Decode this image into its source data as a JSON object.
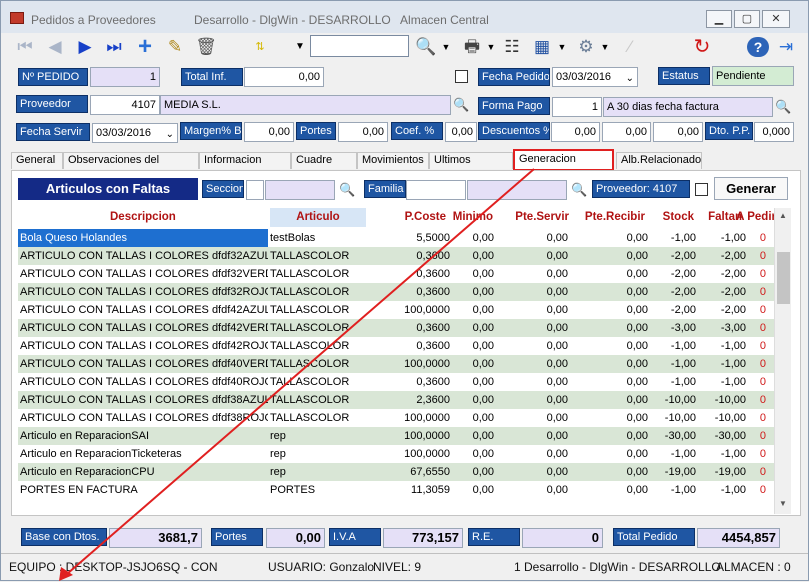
{
  "window": {
    "app_title": "Pedidos a Proveedores",
    "context_title": "Desarrollo - DlgWin - DESARROLLO   Almacen Central"
  },
  "toolbar": {
    "search_value": ""
  },
  "header": {
    "pedido_label": "Nº PEDIDO",
    "pedido_value": "1",
    "total_inf_label": "Total Inf.",
    "total_inf_value": "0,00",
    "fecha_pedido_label": "Fecha Pedido",
    "fecha_pedido_value": "03/03/2016",
    "estatus_label": "Estatus",
    "estatus_value": "Pendiente",
    "proveedor_label": "Proveedor",
    "proveedor_code": "4107",
    "proveedor_name": "MEDIA S.L.",
    "forma_pago_label": "Forma Pago",
    "forma_pago_code": "1",
    "forma_pago_name": "A 30 dias fecha factura",
    "fecha_servir_label": "Fecha Servir",
    "fecha_servir_value": "03/03/2016",
    "margen_label": "Margen% B",
    "margen_value": "0,00",
    "portes_label": "Portes",
    "portes_value": "0,00",
    "coef_label": "Coef. %",
    "coef_value": "0,00",
    "descuentos_label": "Descuentos %",
    "desc1": "0,00",
    "desc2": "0,00",
    "desc3": "0,00",
    "dto_pp_label": "Dto. P.P.",
    "dto_pp_value": "0,000"
  },
  "tabs": [
    "General",
    "Observaciones del Pedido",
    "Informacion Final",
    "Cuadre IVA",
    "Movimientos",
    "Ultimos Precios",
    "Generacion Pedido",
    "Alb.Relacionado"
  ],
  "active_tab": "Generacion Pedido",
  "panel": {
    "title": "Articulos con Faltas",
    "seccion_label": "Seccion",
    "familia_label": "Familia",
    "proveedor_label": "Proveedor: 4107",
    "generar_label": "Generar"
  },
  "grid": {
    "headers": [
      "Descripcion",
      "Articulo",
      "P.Coste",
      "Minimo",
      "Pte.Servir",
      "Pte.Recibir",
      "Stock",
      "Faltan",
      "A Pedir"
    ],
    "rows": [
      [
        "Bola Queso Holandes",
        "testBolas",
        "5,5000",
        "0,00",
        "0,00",
        "0,00",
        "-1,00",
        "-1,00",
        "0"
      ],
      [
        "ARTICULO CON TALLAS I COLORES dfdf32AZUL",
        "TALLASCOLOR",
        "0,3600",
        "0,00",
        "0,00",
        "0,00",
        "-2,00",
        "-2,00",
        "0"
      ],
      [
        "ARTICULO CON TALLAS I COLORES dfdf32VERD",
        "TALLASCOLOR",
        "0,3600",
        "0,00",
        "0,00",
        "0,00",
        "-2,00",
        "-2,00",
        "0"
      ],
      [
        "ARTICULO CON TALLAS I COLORES dfdf32ROJO",
        "TALLASCOLOR",
        "0,3600",
        "0,00",
        "0,00",
        "0,00",
        "-2,00",
        "-2,00",
        "0"
      ],
      [
        "ARTICULO CON TALLAS I COLORES dfdf42AZUL",
        "TALLASCOLOR",
        "100,0000",
        "0,00",
        "0,00",
        "0,00",
        "-2,00",
        "-2,00",
        "0"
      ],
      [
        "ARTICULO CON TALLAS I COLORES dfdf42VERD",
        "TALLASCOLOR",
        "0,3600",
        "0,00",
        "0,00",
        "0,00",
        "-3,00",
        "-3,00",
        "0"
      ],
      [
        "ARTICULO CON TALLAS I COLORES dfdf42ROJO",
        "TALLASCOLOR",
        "0,3600",
        "0,00",
        "0,00",
        "0,00",
        "-1,00",
        "-1,00",
        "0"
      ],
      [
        "ARTICULO CON TALLAS I COLORES dfdf40VERD",
        "TALLASCOLOR",
        "100,0000",
        "0,00",
        "0,00",
        "0,00",
        "-1,00",
        "-1,00",
        "0"
      ],
      [
        "ARTICULO CON TALLAS I COLORES dfdf40ROJO",
        "TALLASCOLOR",
        "0,3600",
        "0,00",
        "0,00",
        "0,00",
        "-1,00",
        "-1,00",
        "0"
      ],
      [
        "ARTICULO CON TALLAS I COLORES dfdf38AZUL",
        "TALLASCOLOR",
        "2,3600",
        "0,00",
        "0,00",
        "0,00",
        "-10,00",
        "-10,00",
        "0"
      ],
      [
        "ARTICULO CON TALLAS I COLORES dfdf38ROJO",
        "TALLASCOLOR",
        "100,0000",
        "0,00",
        "0,00",
        "0,00",
        "-10,00",
        "-10,00",
        "0"
      ],
      [
        "Articulo en ReparacionSAI",
        "rep",
        "100,0000",
        "0,00",
        "0,00",
        "0,00",
        "-30,00",
        "-30,00",
        "0"
      ],
      [
        "Articulo en ReparacionTicketeras",
        "rep",
        "100,0000",
        "0,00",
        "0,00",
        "0,00",
        "-1,00",
        "-1,00",
        "0"
      ],
      [
        "Articulo en ReparacionCPU",
        "rep",
        "67,6550",
        "0,00",
        "0,00",
        "0,00",
        "-19,00",
        "-19,00",
        "0"
      ],
      [
        "PORTES EN FACTURA",
        "PORTES",
        "11,3059",
        "0,00",
        "0,00",
        "0,00",
        "-1,00",
        "-1,00",
        "0"
      ]
    ]
  },
  "totals": {
    "base_label": "Base con Dtos.",
    "base_value": "3681,7",
    "portes_label": "Portes",
    "portes_value": "0,00",
    "iva_label": "I.V.A",
    "iva_value": "773,157",
    "re_label": "R.E.",
    "re_value": "0",
    "total_label": "Total Pedido",
    "total_value": "4454,857"
  },
  "status": {
    "equipo": "EQUIPO : DESKTOP-JSJO6SQ - CON",
    "usuario": "USUARIO: Gonzalo",
    "nivel": "NIVEL: 9",
    "empresa": "1 Desarrollo - DlgWin - DESARROLLO",
    "almacen": "ALMACEN : 0"
  },
  "colors": {
    "label_bg": "#1f56a3",
    "header_text": "#b01313",
    "row_alt": "#d9e6d6",
    "selected_row": "#1e6fd0",
    "annotation": "#e02020"
  }
}
